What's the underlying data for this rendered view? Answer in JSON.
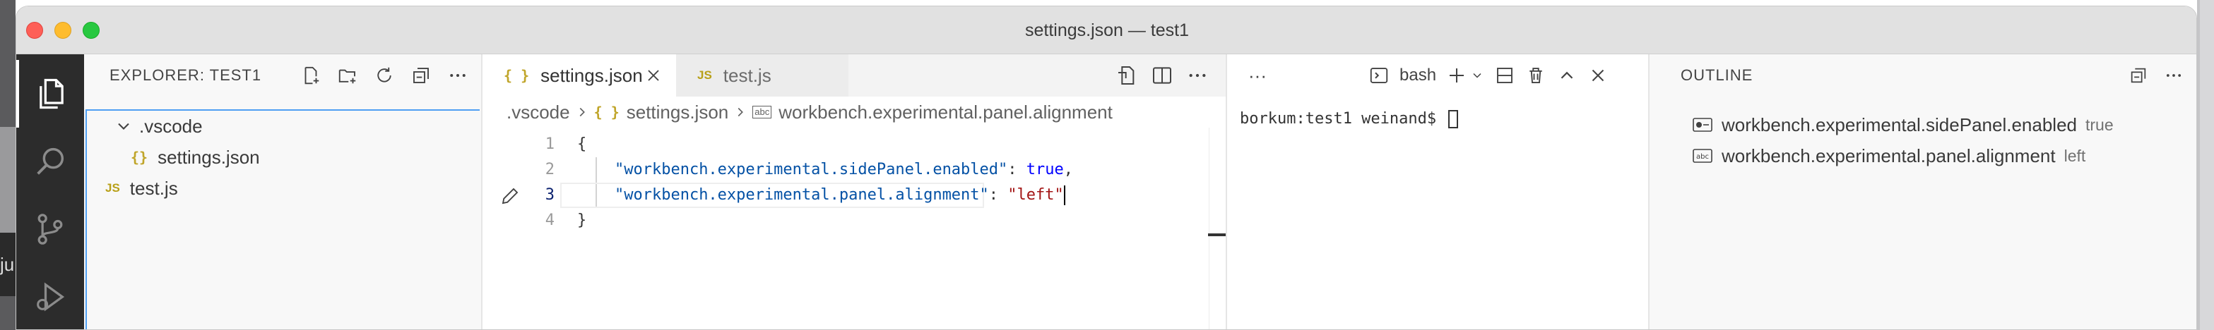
{
  "window": {
    "title": "settings.json — test1"
  },
  "desktop": {
    "left_fragment": "ju"
  },
  "activity_bar": {
    "items": [
      {
        "name": "explorer",
        "icon": "files-icon",
        "active": true
      },
      {
        "name": "search",
        "icon": "search-icon",
        "active": false
      },
      {
        "name": "source-control",
        "icon": "source-control-icon",
        "active": false
      },
      {
        "name": "run-debug",
        "icon": "debug-icon",
        "active": false
      }
    ]
  },
  "explorer": {
    "title": "EXPLORER: TEST1",
    "toolbar": [
      "new-file-icon",
      "new-folder-icon",
      "refresh-icon",
      "collapse-all-icon",
      "more-icon"
    ],
    "tree": [
      {
        "label": ".vscode",
        "type": "folder",
        "expanded": true,
        "depth": 0
      },
      {
        "label": "settings.json",
        "type": "json",
        "depth": 1
      },
      {
        "label": "test.js",
        "type": "js",
        "depth": 0
      }
    ]
  },
  "editor": {
    "tabs": [
      {
        "label": "settings.json",
        "icon_text": "{ }",
        "active": true
      },
      {
        "label": "test.js",
        "icon_text": "JS",
        "active": false
      }
    ],
    "toolbar": [
      "open-changes-icon",
      "split-editor-icon",
      "more-icon"
    ],
    "breadcrumbs": [
      ".vscode",
      "settings.json",
      "workbench.experimental.panel.alignment"
    ],
    "breadcrumb_icons": {
      "json": "{ }",
      "string": "abc"
    },
    "lines": [
      {
        "num": "1",
        "parts": [
          {
            "cls": "p",
            "text": "{"
          }
        ]
      },
      {
        "num": "2",
        "parts": [
          {
            "cls": "p",
            "text": "    "
          },
          {
            "cls": "k",
            "text": "\"workbench.experimental.sidePanel.enabled\""
          },
          {
            "cls": "p",
            "text": ": "
          },
          {
            "cls": "kw",
            "text": "true"
          },
          {
            "cls": "p",
            "text": ","
          }
        ]
      },
      {
        "num": "3",
        "parts": [
          {
            "cls": "p",
            "text": "    "
          },
          {
            "cls": "k",
            "text": "\"workbench.experimental.panel.alignment\""
          },
          {
            "cls": "p",
            "text": ": "
          },
          {
            "cls": "s",
            "text": "\"left\""
          }
        ],
        "current": true
      },
      {
        "num": "4",
        "parts": [
          {
            "cls": "p",
            "text": "}"
          }
        ]
      }
    ]
  },
  "terminal": {
    "more_label": "···",
    "shell_label": "bash",
    "prompt": "borkum:test1 weinand$ ",
    "toolbar": [
      "terminal-icon",
      "plus-icon",
      "chevron-down-icon",
      "split-terminal-icon",
      "trash-icon",
      "maximize-panel-icon",
      "close-icon"
    ]
  },
  "outline": {
    "title": "OUTLINE",
    "toolbar": [
      "collapse-all-icon",
      "more-icon"
    ],
    "items": [
      {
        "label": "workbench.experimental.sidePanel.enabled",
        "detail": "true",
        "icon": "boolean-icon"
      },
      {
        "label": "workbench.experimental.panel.alignment",
        "detail": "left",
        "icon": "string-icon"
      }
    ]
  },
  "colors": {
    "accent": "#4e9ff3",
    "activity_bg": "#2c2c2c",
    "json_key": "#0451a5",
    "json_keyword": "#0000ff",
    "json_string": "#a31515"
  }
}
